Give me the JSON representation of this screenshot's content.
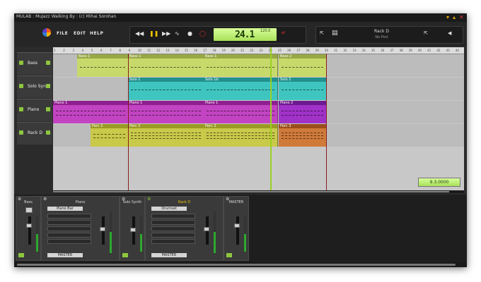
{
  "window": {
    "title": "MULAB : MuJazz Walking By : (c) Mihai Sorohan"
  },
  "menu": {
    "file": "FILE",
    "edit": "EDIT",
    "help": "HELP"
  },
  "transport": {
    "position": "24.1",
    "tempo": "120.0"
  },
  "rack_panel": {
    "name": "Rack D",
    "port": "No Port"
  },
  "ruler": {
    "ticks": [
      "1",
      "2",
      "3",
      "4",
      "5",
      "6",
      "7",
      "8",
      "9",
      "10",
      "11",
      "12",
      "13",
      "14",
      "15",
      "16",
      "17",
      "18",
      "19",
      "20",
      "21",
      "22",
      "23",
      "24",
      "25",
      "26",
      "27",
      "28",
      "29",
      "30",
      "31",
      "32",
      "33",
      "34",
      "35",
      "36",
      "37",
      "38",
      "39",
      "40",
      "41",
      "42",
      "43",
      "44"
    ]
  },
  "tracks": [
    {
      "name": "Bass"
    },
    {
      "name": "Solo Syn"
    },
    {
      "name": "Piano"
    },
    {
      "name": "Rack D"
    }
  ],
  "clips": {
    "bass": [
      "Bass 1",
      "Bass 1",
      "Bass 1",
      "Bass 2"
    ],
    "solo": [
      "Solo 1",
      "Solo 1b",
      "Solo 2"
    ],
    "piano": [
      "Piano 1",
      "Piano 1",
      "Piano 1",
      "Piano 2"
    ],
    "perc": [
      "Perc 1",
      "Perc 2",
      "Perc 2",
      "Perc 3"
    ]
  },
  "zoom": "9.3.0000",
  "mixer": {
    "strips": [
      {
        "name": "Bass"
      },
      {
        "name": "Piano",
        "instrument": "Piano Bar",
        "output": "MASTER"
      },
      {
        "name": "Solo Synth"
      },
      {
        "name": "Rack D",
        "instrument": "Drumset",
        "output": "MASTER"
      },
      {
        "name": "MASTER"
      }
    ]
  },
  "colors": {
    "bass": "#c8d96b",
    "solo": "#3fc5c0",
    "piano": "#c244c2",
    "perc": "#c9c94a",
    "accent": "#9ad123"
  }
}
